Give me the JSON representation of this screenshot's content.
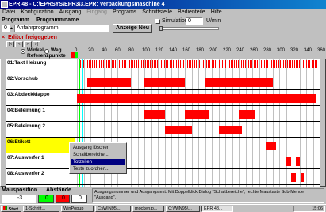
{
  "window": {
    "title": "EPR 48 - C:\\EPRSYS\\EPR3\\3.EPR: Verpackungsmaschine 4",
    "menu": [
      "Datei",
      "Konfiguration",
      "Ausgang",
      "Eingang",
      "Programs",
      "Schnittstelle",
      "Bedienteile",
      "Hilfe"
    ],
    "menu_disabled": [
      false,
      false,
      false,
      true,
      false,
      false,
      false,
      false
    ]
  },
  "toolbar": {
    "program_label": "Programm",
    "programname_label": "Programmname",
    "program_number": "0",
    "program_name": "Anfahrprogramm",
    "show_new_button": "Anzeige Neu",
    "simulation_label": "Simulation",
    "simulation_value": "0",
    "unit": "U/min"
  },
  "editor": {
    "title": "Editor freigegeben",
    "nav_buttons": [
      "|<",
      "<",
      ">",
      ">|"
    ],
    "radio_angle": "Winkel",
    "radio_path": "Weg",
    "ref_points": "Referenzpunkte",
    "angle_ticks": [
      "0",
      "20",
      "40",
      "60",
      "80",
      "100",
      "120",
      "140",
      "160",
      "180",
      "200",
      "220",
      "240",
      "260",
      "280",
      "300",
      "320",
      "340",
      "360"
    ]
  },
  "rows": [
    {
      "label": "01:Takt Heizung",
      "highlight": false,
      "bars": [],
      "ticks": true
    },
    {
      "label": "02:Vorschub",
      "highlight": false,
      "bars": [
        [
          15,
          80
        ],
        [
          100,
          160
        ],
        [
          190,
          290
        ]
      ],
      "ticks": false
    },
    {
      "label": "03:Abdeckklappe",
      "highlight": false,
      "bars": [
        [
          0,
          355
        ]
      ],
      "ticks": false
    },
    {
      "label": "04:Beleimung 1",
      "highlight": false,
      "bars": [
        [
          100,
          130
        ],
        [
          160,
          195
        ],
        [
          240,
          265
        ]
      ],
      "ticks": false
    },
    {
      "label": "05:Beleimung 2",
      "highlight": false,
      "bars": [
        [
          130,
          170
        ],
        [
          210,
          245
        ]
      ],
      "ticks": false
    },
    {
      "label": "06:Etikett",
      "highlight": true,
      "bars": [
        [
          280,
          295
        ]
      ],
      "ticks": false
    },
    {
      "label": "07:Auswerfer 1",
      "highlight": false,
      "bars": [
        [
          310,
          318
        ],
        [
          325,
          330
        ]
      ],
      "ticks": false
    },
    {
      "label": "08:Auswerfer 2",
      "highlight": false,
      "bars": [
        [
          318,
          325
        ],
        [
          333,
          336
        ]
      ],
      "ticks": false
    }
  ],
  "context_menu": {
    "items": [
      "Ausgang löschen",
      "Schaltbereiche...",
      "Totzeiten",
      "Texte zuordnen..."
    ],
    "selected_index": 2
  },
  "status": {
    "position_label": "Mausposition",
    "distances_label": "Abstände",
    "position_value": "-3",
    "distance_values": [
      "0",
      "0",
      "0"
    ],
    "message": "Ausgangsnummer und Ausgangstext. Mit Doppelklick Dialog \"Schaltbereiche\", rechte Maustaste Sub-Menue \"Ausgang\"."
  },
  "taskbar": {
    "start": "Start",
    "tasks": [
      "1-Schrift...",
      "WinPopup",
      "C:\\WIN95\\...",
      "mocken.p...",
      "C:\\WIN95\\...",
      "EPR 48..."
    ],
    "active_index": 5,
    "clock": "15:06"
  },
  "colors": {
    "title_bg": "#000080",
    "bar": "#ff0000",
    "highlight_row": "#ffff00",
    "editor_text": "#c00000"
  }
}
